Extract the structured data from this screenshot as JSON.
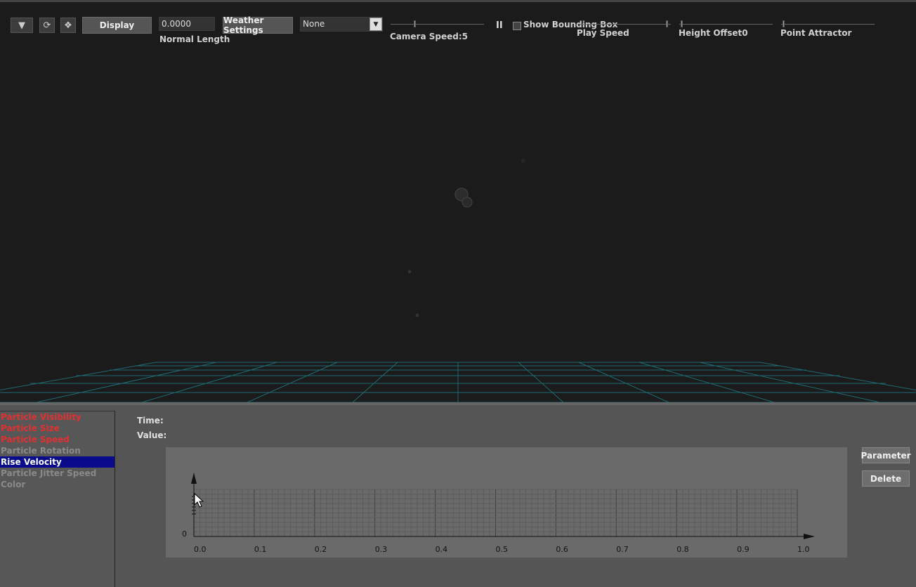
{
  "toolbar": {
    "icons": [
      "filter-icon",
      "refresh-icon",
      "scatter-icon"
    ],
    "display_label": "Display",
    "normal_length_value": "0.0000",
    "normal_length_label": "Normal Length",
    "weather_settings_label": "Weather Settings",
    "preset_value": "None",
    "camera_speed_label": "Camera Speed:5",
    "pause_glyph": "II",
    "show_bounding_box_label": "Show Bounding Box",
    "play_speed_label": "Play Speed",
    "height_offset_label": "Height Offset0",
    "point_attractor_label": "Point Attractor"
  },
  "params": [
    {
      "label": "Particle Visibility",
      "state": "active-red"
    },
    {
      "label": "Particle Size",
      "state": "active-red"
    },
    {
      "label": "Particle Speed",
      "state": "active-red"
    },
    {
      "label": "Particle Rotation",
      "state": "dim"
    },
    {
      "label": "Rise Velocity",
      "state": "selected"
    },
    {
      "label": "Particle Jitter Speed",
      "state": "dim"
    },
    {
      "label": "Color",
      "state": "dim"
    }
  ],
  "curve": {
    "time_label": "Time:",
    "value_label": "Value:",
    "y_tick": "0",
    "x_ticks": [
      "0.0",
      "0.1",
      "0.2",
      "0.3",
      "0.4",
      "0.5",
      "0.6",
      "0.7",
      "0.8",
      "0.9",
      "1.0"
    ]
  },
  "actions": {
    "parameter_label": "Parameter",
    "delete_label": "Delete"
  },
  "colors": {
    "active_param": "#e23030",
    "selected_param_bg": "#0a0a8c",
    "grid_floor": "#1f6f78"
  }
}
